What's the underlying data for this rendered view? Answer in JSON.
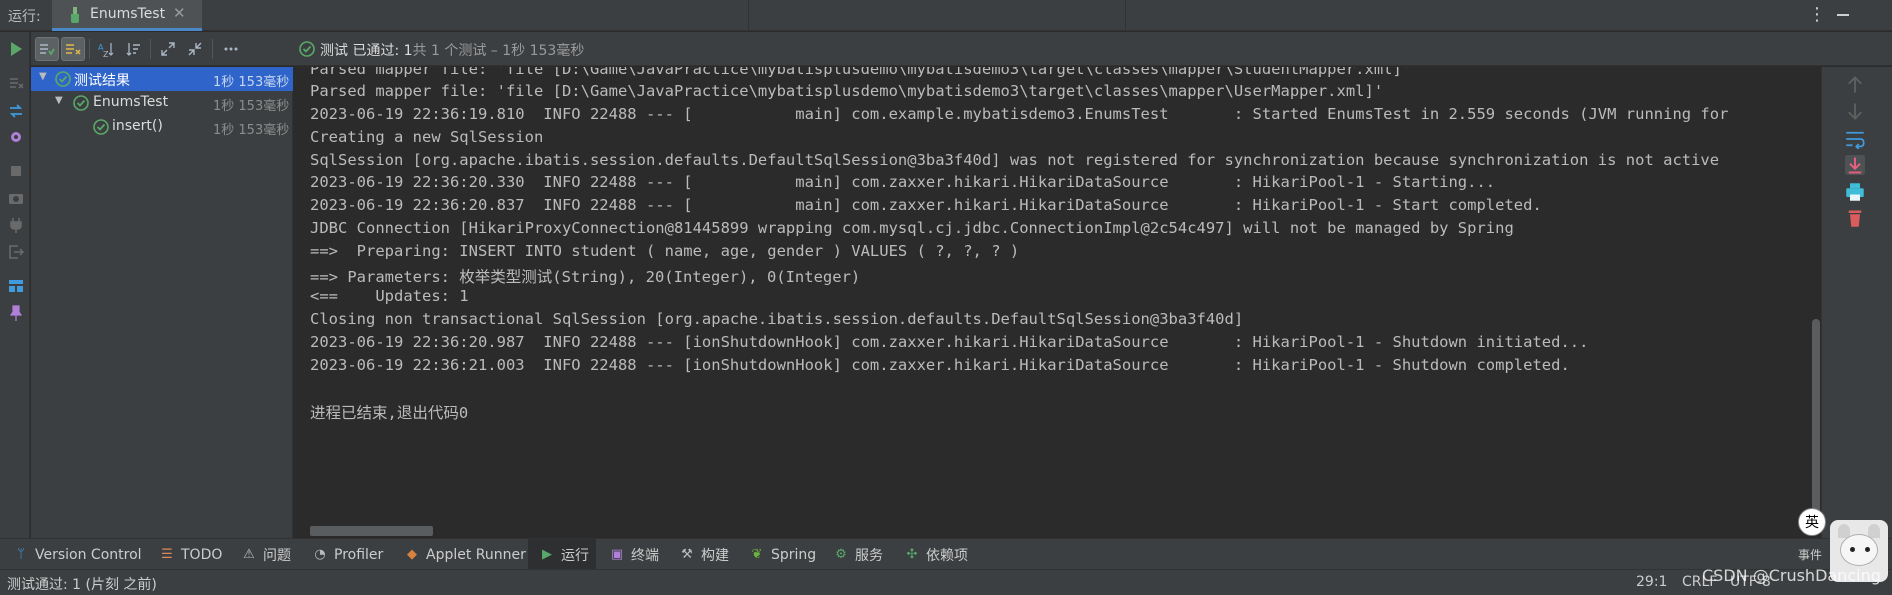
{
  "run_bar": {
    "label": "运行:",
    "tab": {
      "title": "EnumsTest",
      "close": "✕",
      "icon": "test-flask-icon"
    },
    "more_icon": "⋮"
  },
  "test_status": {
    "passed_label": "测试 已通过: 1",
    "detail": "共 1 个测试 – 1秒 153毫秒"
  },
  "tree": [
    {
      "label": "测试结果",
      "time": "1秒 153毫秒",
      "selected": true
    },
    {
      "label": "EnumsTest",
      "time": "1秒 153毫秒",
      "selected": false
    },
    {
      "label": "insert()",
      "time": "1秒 153毫秒",
      "selected": false
    }
  ],
  "console_lines": [
    "Parsed mapper file: 'file [D:\\Game\\JavaPractice\\mybatisplusdemo\\mybatisdemo3\\target\\classes\\mapper\\StudentMapper.xml]'",
    "Parsed mapper file: 'file [D:\\Game\\JavaPractice\\mybatisplusdemo\\mybatisdemo3\\target\\classes\\mapper\\UserMapper.xml]'",
    "2023-06-19 22:36:19.810  INFO 22488 --- [           main] com.example.mybatisdemo3.EnumsTest       : Started EnumsTest in 2.559 seconds (JVM running for",
    "Creating a new SqlSession",
    "SqlSession [org.apache.ibatis.session.defaults.DefaultSqlSession@3ba3f40d] was not registered for synchronization because synchronization is not active",
    "2023-06-19 22:36:20.330  INFO 22488 --- [           main] com.zaxxer.hikari.HikariDataSource       : HikariPool-1 - Starting...",
    "2023-06-19 22:36:20.837  INFO 22488 --- [           main] com.zaxxer.hikari.HikariDataSource       : HikariPool-1 - Start completed.",
    "JDBC Connection [HikariProxyConnection@81445899 wrapping com.mysql.cj.jdbc.ConnectionImpl@2c54c497] will not be managed by Spring",
    "==>  Preparing: INSERT INTO student ( name, age, gender ) VALUES ( ?, ?, ? )",
    "==> Parameters: 枚举类型测试(String), 20(Integer), 0(Integer)",
    "<==    Updates: 1",
    "Closing non transactional SqlSession [org.apache.ibatis.session.defaults.DefaultSqlSession@3ba3f40d]",
    "2023-06-19 22:36:20.987  INFO 22488 --- [ionShutdownHook] com.zaxxer.hikari.HikariDataSource       : HikariPool-1 - Shutdown initiated...",
    "2023-06-19 22:36:21.003  INFO 22488 --- [ionShutdownHook] com.zaxxer.hikari.HikariDataSource       : HikariPool-1 - Shutdown completed.",
    "",
    "进程已结束,退出代码0"
  ],
  "tool_windows": [
    {
      "label": "Version Control",
      "icon": "version-control-icon",
      "glyph": "ᛘ"
    },
    {
      "label": "TODO",
      "icon": "todo-icon",
      "glyph": "☰"
    },
    {
      "label": "问题",
      "icon": "problems-icon",
      "glyph": "⚠"
    },
    {
      "label": "Profiler",
      "icon": "profiler-icon",
      "glyph": "◔"
    },
    {
      "label": "Applet Runner",
      "icon": "applet-runner-icon",
      "glyph": "◆"
    },
    {
      "label": "运行",
      "icon": "run-icon",
      "glyph": "▶"
    },
    {
      "label": "终端",
      "icon": "terminal-icon",
      "glyph": "▣"
    },
    {
      "label": "构建",
      "icon": "build-icon",
      "glyph": "⚒"
    },
    {
      "label": "Spring",
      "icon": "spring-icon",
      "glyph": "❦"
    },
    {
      "label": "服务",
      "icon": "services-icon",
      "glyph": "⚙"
    },
    {
      "label": "依赖项",
      "icon": "dependencies-icon",
      "glyph": "✣"
    }
  ],
  "status_bar": {
    "message": "测试通过: 1 (片刻 之前)",
    "caret": "29:1",
    "line_separator": "CRLF",
    "encoding": "UTF-8"
  },
  "overlay": {
    "ime": "英",
    "events": "事件",
    "watermark": "CSDN @CrushDancing"
  },
  "colors": {
    "accent": "#2f65ca",
    "pass_green": "#499c54",
    "run_green": "#59a869",
    "tab_underline": "#4a88c7",
    "danger_red": "#db5c5c"
  }
}
